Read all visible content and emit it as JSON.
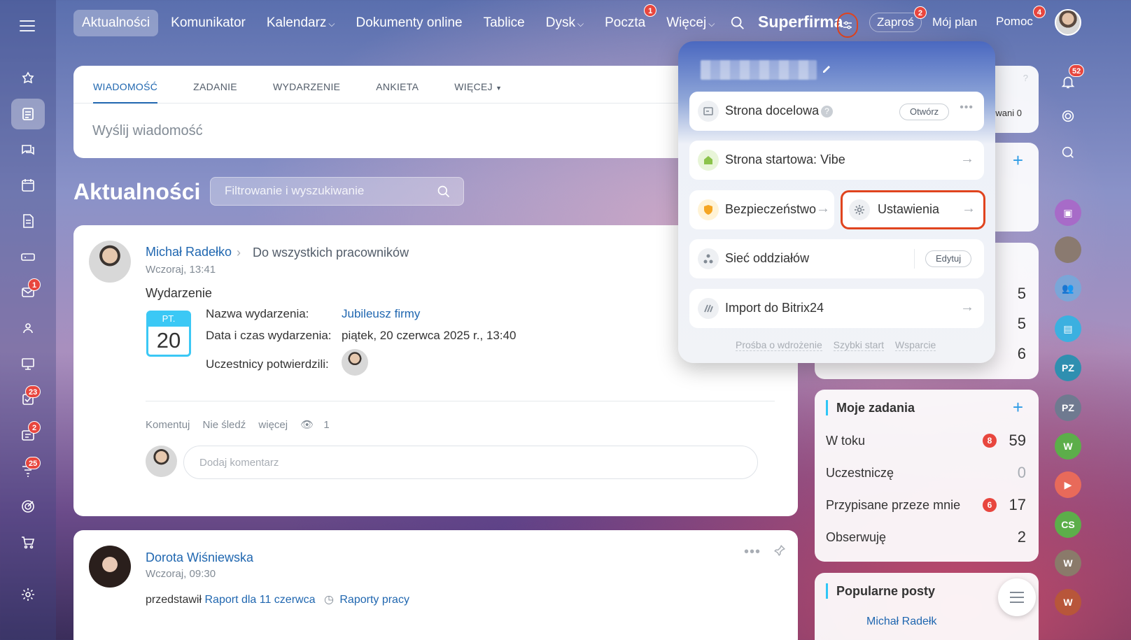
{
  "nav": {
    "items": [
      {
        "label": "Aktualności",
        "active": true
      },
      {
        "label": "Komunikator"
      },
      {
        "label": "Kalendarz",
        "chevron": true
      },
      {
        "label": "Dokumenty online"
      },
      {
        "label": "Tablice"
      },
      {
        "label": "Dysk",
        "chevron": true
      },
      {
        "label": "Poczta",
        "badge": "1"
      },
      {
        "label": "Więcej",
        "chevron": true
      }
    ],
    "brand": "Superfirma",
    "invite": "Zaproś",
    "invite_badge": "2",
    "plan": "Mój plan",
    "help": "Pomoc",
    "help_badge": "4"
  },
  "rail": {
    "mail_badge": "1",
    "tasks_badge": "23",
    "crm_badge": "2",
    "feed_badge": "25"
  },
  "composer": {
    "tabs": [
      "WIADOMOŚĆ",
      "ZADANIE",
      "WYDARZENIE",
      "ANKIETA",
      "WIĘCEJ"
    ],
    "placeholder": "Wyślij wiadomość"
  },
  "page": {
    "title": "Aktualności",
    "filter_placeholder": "Filtrowanie i wyszukiwanie"
  },
  "post1": {
    "author": "Michał Radełko",
    "recipient": "Do wszystkich pracowników",
    "time": "Wczoraj, 13:41",
    "type": "Wydarzenie",
    "cal_dow": "PT.",
    "cal_day": "20",
    "event_name_label": "Nazwa wydarzenia:",
    "event_name": "Jubileusz firmy",
    "event_date_label": "Data i czas wydarzenia:",
    "event_date": "piątek, 20 czerwca 2025 r., 13:40",
    "participants_label": "Uczestnicy potwierdzili:",
    "action_comment": "Komentuj",
    "action_unfollow": "Nie śledź",
    "action_more": "więcej",
    "views": "1",
    "comment_placeholder": "Dodaj komentarz"
  },
  "post2": {
    "author": "Dorota Wiśniewska",
    "time": "Wczoraj, 09:30",
    "text_prefix": "przedstawił",
    "report": "Raport dla 11 czerwca",
    "reports_link": "Raporty pracy"
  },
  "widgets": {
    "top_partial": "wani 0",
    "counts": [
      "5",
      "5",
      "6"
    ],
    "tasks_title": "Moje zadania",
    "tasks": [
      {
        "label": "W toku",
        "badge": "8",
        "count": "59"
      },
      {
        "label": "Uczestniczę",
        "count": "0"
      },
      {
        "label": "Przypisane przeze mnie",
        "badge": "6",
        "count": "17"
      },
      {
        "label": "Obserwuję",
        "count": "2"
      }
    ],
    "popular_title": "Popularne posty",
    "popular_partial": "Michał Radełk"
  },
  "right_rail": {
    "notif_badge": "52",
    "initials": [
      "PZ",
      "PZ",
      "W",
      "CS",
      "W",
      "W"
    ]
  },
  "popup": {
    "landing": "Strona docelowa",
    "open_btn": "Otwórz",
    "start": "Strona startowa: Vibe",
    "security": "Bezpieczeństwo",
    "settings": "Ustawienia",
    "branches": "Sieć oddziałów",
    "edit_btn": "Edytuj",
    "import": "Import do Bitrix24",
    "links": [
      "Prośba o wdrożenie",
      "Szybki start",
      "Wsparcie"
    ]
  },
  "colors": {
    "accent": "#2067b0",
    "badge": "#e8463e",
    "highlight": "#e0441e",
    "calendar": "#3bc8f5"
  }
}
